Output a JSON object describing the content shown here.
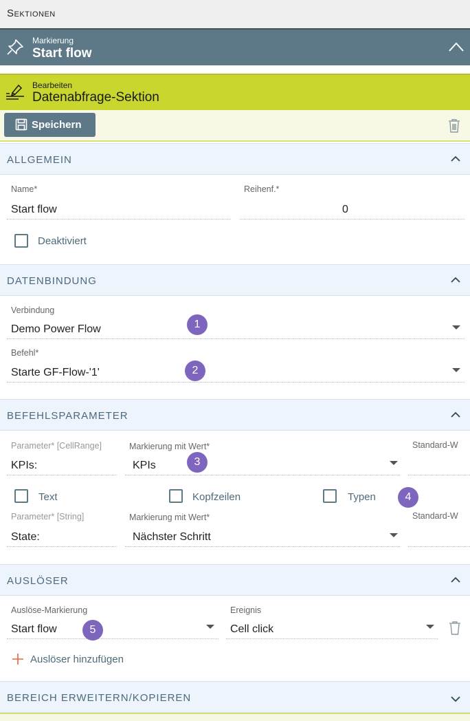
{
  "header": {
    "title": "Sektionen"
  },
  "marker": {
    "small": "Markierung",
    "title": "Start flow"
  },
  "edit": {
    "small": "Bearbeiten",
    "title": "Datenabfrage-Sektion"
  },
  "toolbar": {
    "save_label": "Speichern"
  },
  "sections": {
    "general": {
      "title": "ALLGEMEIN",
      "name_label": "Name*",
      "name_value": "Start flow",
      "order_label": "Reihenf.*",
      "order_value": "0",
      "disabled_label": "Deaktiviert"
    },
    "binding": {
      "title": "DATENBINDUNG",
      "connection_label": "Verbindung",
      "connection_value": "Demo Power Flow",
      "command_label": "Befehl*",
      "command_value": "Starte GF-Flow-'1'"
    },
    "params": {
      "title": "BEFEHLSPARAMETER",
      "rows": [
        {
          "param_label": "Parameter* [CellRange]",
          "param_value": "KPIs:",
          "mark_label": "Markierung mit Wert*",
          "mark_value": "KPIs",
          "default_label": "Standard-W"
        },
        {
          "param_label": "Parameter* [String]",
          "param_value": "State:",
          "mark_label": "Markierung mit Wert*",
          "mark_value": "Nächster Schritt",
          "default_label": "Standard-W"
        }
      ],
      "checks": [
        "Text",
        "Kopfzeilen",
        "Typen"
      ]
    },
    "triggers": {
      "title": "AUSLÖSER",
      "marker_label": "Auslöse-Markierung",
      "marker_value": "Start flow",
      "event_label": "Ereignis",
      "event_value": "Cell click",
      "add_label": "Auslöser hinzufügen"
    },
    "extend": {
      "title": "BEREICH ERWEITERN/KOPIEREN"
    }
  },
  "badges": [
    "1",
    "2",
    "3",
    "4",
    "5"
  ],
  "colors": {
    "accent": "#5d7886",
    "edit_bar": "#c8d62e",
    "badge": "#7e65bd",
    "add_plus": "#e8643c",
    "section_bg": "#eef4fb"
  },
  "icons": {
    "marker": "pushpin-icon",
    "edit": "edit-pen-icon",
    "save": "floppy-disk-icon",
    "delete": "trash-icon",
    "add": "plus-icon",
    "collapse": "chevron-up-icon",
    "expand": "chevron-down-icon",
    "dropdown": "caret-down-icon"
  }
}
